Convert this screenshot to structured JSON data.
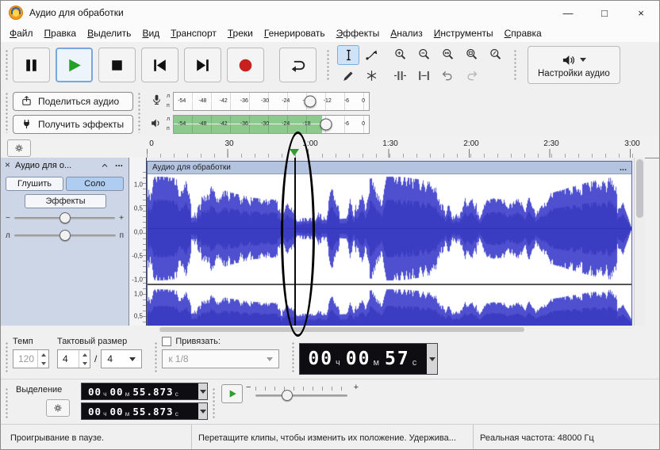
{
  "window": {
    "title": "Аудио для обработки",
    "minimize": "—",
    "maximize": "□",
    "close": "×"
  },
  "menu": {
    "items": [
      "Файл",
      "Правка",
      "Выделить",
      "Вид",
      "Транспорт",
      "Треки",
      "Генерировать",
      "Эффекты",
      "Анализ",
      "Инструменты",
      "Справка"
    ]
  },
  "audio_setup": {
    "label": "Настройки аудио"
  },
  "share": {
    "share_label": "Поделиться аудио",
    "effects_label": "Получить эффекты"
  },
  "meters": {
    "scale": [
      "-54",
      "-48",
      "-42",
      "-36",
      "-30",
      "-24",
      "-18",
      "-12",
      "-6",
      "0"
    ],
    "left": "л",
    "right": "п"
  },
  "timeline": {
    "labels": [
      "0",
      "30",
      "1:00",
      "1:30",
      "2:00",
      "2:30",
      "3:00"
    ]
  },
  "track": {
    "close": "×",
    "name": "Аудио для о...",
    "menu": "...",
    "mute": "Глушить",
    "solo": "Соло",
    "effects": "Эффекты",
    "gain_minus": "−",
    "gain_plus": "+",
    "pan_left": "л",
    "pan_right": "п",
    "ruler_ch1": [
      "1,0",
      "0,5",
      "0,0",
      "-0,5",
      "-1,0"
    ],
    "ruler_ch2": [
      "1,0",
      "0,5"
    ],
    "clip_title": "Аудио для обработки",
    "clip_menu": "..."
  },
  "tempo": {
    "label": "Темп",
    "value": "120"
  },
  "time_signature": {
    "label": "Тактовый размер",
    "upper": "4",
    "divider": "/",
    "lower": "4"
  },
  "snap": {
    "label": "Привязать:",
    "value": "к 1/8"
  },
  "time_display": {
    "h": "00",
    "h_unit": "ч",
    "m": "00",
    "m_unit": "м",
    "s": "57",
    "s_unit": "с"
  },
  "selection": {
    "label": "Выделение",
    "start": {
      "h": "00",
      "h_unit": "ч",
      "m": "00",
      "m_unit": "м",
      "s": "55.873",
      "s_unit": "с"
    },
    "end": {
      "h": "00",
      "h_unit": "ч",
      "m": "00",
      "m_unit": "м",
      "s": "55.873",
      "s_unit": "с"
    },
    "speed_minus": "−",
    "speed_plus": "+"
  },
  "status": {
    "playback": "Проигрывание в паузе.",
    "hint": "Перетащите клипы, чтобы изменить их положение. Удержива...",
    "rate": "Реальная частота: 48000 Гц"
  }
}
